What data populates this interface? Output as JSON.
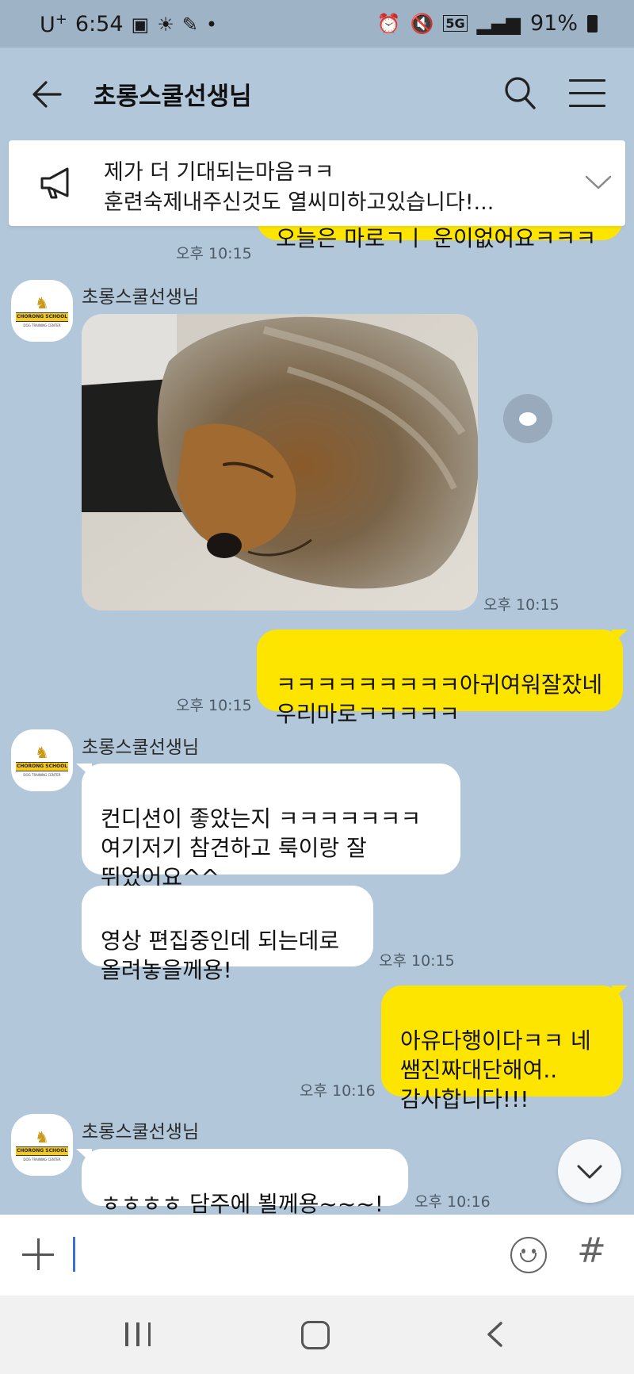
{
  "status_bar": {
    "carrier": "U",
    "carrier_suffix": "+",
    "time": "6:54",
    "network": "5G",
    "battery": "91%"
  },
  "header": {
    "title": "초롱스쿨선생님"
  },
  "notice": {
    "line1": "제가 더 기대되는마음ㅋㅋ",
    "line2": "훈련숙제내주신것도 열씨미하고있습니다!..."
  },
  "messages": [
    {
      "id": "m0",
      "from": "me",
      "text": "오늘은 마로ㄱㅣ 운이없어요ㅋㅋㅋ",
      "time": "오후 10:15"
    },
    {
      "id": "m1",
      "from": "them",
      "sender": "초롱스쿨선생님",
      "type": "photo",
      "time": "오후 10:15"
    },
    {
      "id": "m2",
      "from": "me",
      "text": "ㅋㅋㅋㅋㅋㅋㅋㅋㅋ아귀여워잘잤네\n우리마로ㅋㅋㅋㅋㅋ",
      "time": "오후 10:15"
    },
    {
      "id": "m3",
      "from": "them",
      "sender": "초롱스쿨선생님",
      "text": "컨디션이 좋았는지 ㅋㅋㅋㅋㅋㅋㅋ\n여기저기 참견하고 룩이랑 잘\n뛰었어요^^"
    },
    {
      "id": "m4",
      "from": "them",
      "text": "영상 편집중인데 되는데로\n올려놓을께용!",
      "time": "오후 10:15"
    },
    {
      "id": "m5",
      "from": "me",
      "text": "아유다행이다ㅋㅋ 네\n쌤진짜대단해여..\n감사합니다!!!",
      "time": "오후 10:16"
    },
    {
      "id": "m6",
      "from": "them",
      "sender": "초롱스쿨선생님",
      "text": "ㅎㅎㅎㅎ 담주에 뵐께용~~~!",
      "time": "오후 10:16"
    }
  ],
  "avatar": {
    "label": "CHORONG SCHOOL",
    "sublabel": "DOG TRAINING CENTER"
  },
  "input": {
    "value": "",
    "hash_label": "#"
  },
  "icons": {
    "back": "arrow-left-icon",
    "search": "search-icon",
    "menu": "hamburger-menu-icon",
    "notice": "megaphone-icon",
    "expand": "chevron-down-icon",
    "share": "chat-bubble-icon",
    "plus": "plus-icon",
    "emoji": "smiley-icon",
    "hash": "hashtag-icon"
  },
  "colors": {
    "chat_background": "#b2c7da",
    "my_bubble": "#fee500",
    "their_bubble": "#ffffff"
  }
}
